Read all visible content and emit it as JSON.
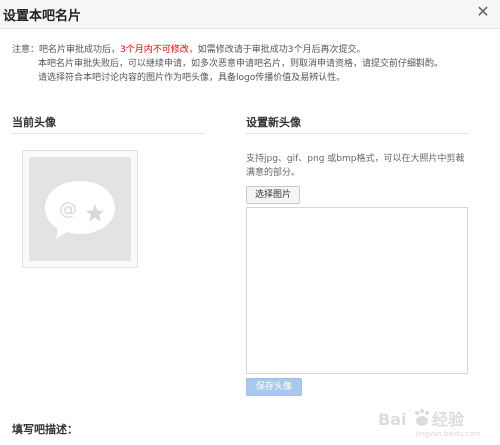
{
  "dialog": {
    "title": "设置本吧名片",
    "close_symbol": "✕"
  },
  "notice": {
    "line1_prefix": "注意：吧名片审批成功后，",
    "line1_red": "3个月内不可修改",
    "line1_suffix": "，如需修改请于审批成功3个月后再次提交。",
    "line2": "本吧名片审批失败后，可以继续申请，如多次恶意申请吧名片，则取消申请资格，请提交前仔细斟酌。",
    "line3": "请选择符合本吧讨论内容的图片作为吧头像，具备logo传播价值及易辨认性。"
  },
  "current_avatar": {
    "title": "当前头像"
  },
  "new_avatar": {
    "title": "设置新头像",
    "description": "支持jpg、gif、png 或bmp格式，可以在大照片中剪裁满意的部分。",
    "choose_button": "选择图片",
    "save_button": "保存头像"
  },
  "footer": {
    "description_label": "填写吧描述："
  },
  "watermark": {
    "brand": "Bai",
    "brand_tail": "经验",
    "sub": "jingyan.baidu.com"
  },
  "colors": {
    "accent_red": "#e10602",
    "save_button_bg": "#a9c8ef"
  },
  "icons": {
    "avatar_placeholder": "chat-bubble-at-star-icon",
    "close": "close-icon"
  }
}
